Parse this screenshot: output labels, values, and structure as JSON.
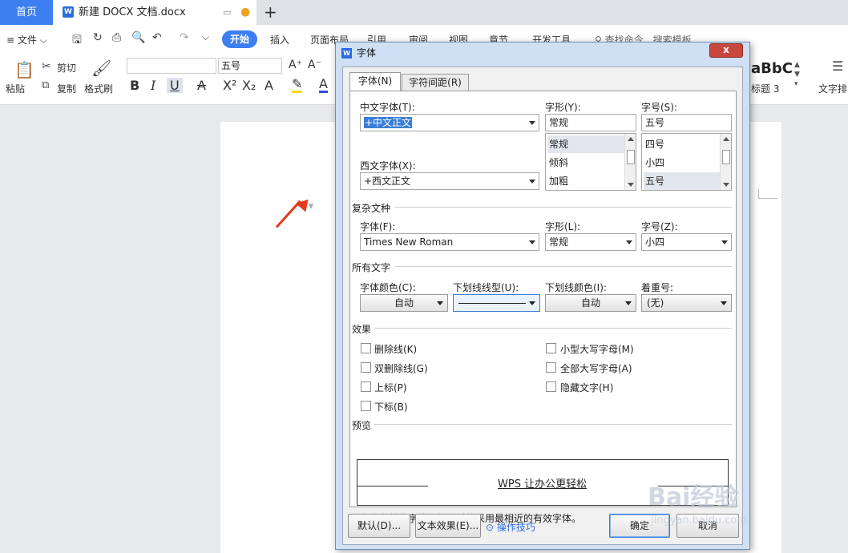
{
  "tabs": {
    "home": "首页",
    "doc_title": "新建 DOCX 文档.docx",
    "new_tab": "+"
  },
  "menu": {
    "file": "文件",
    "start": "开始",
    "insert": "插入",
    "layout": "页面布局",
    "reference": "引用",
    "review": "审阅",
    "view": "视图",
    "section": "章节",
    "dev": "开发工具",
    "search": "查找命令、搜索模板"
  },
  "ribbon": {
    "cut": "剪切",
    "paste": "粘贴",
    "copy": "复制",
    "format_painter": "格式刷",
    "font_size": "五号",
    "style_preview": "aBbC",
    "style_name": "标题 3",
    "text_layout": "文字排"
  },
  "dialog": {
    "title": "字体",
    "close": "x",
    "tab_font": "字体(N)",
    "tab_spacing": "字符间距(R)",
    "cn_font_label": "中文字体(T):",
    "cn_font_value": "+中文正文",
    "style_label": "字形(Y):",
    "style_value": "常规",
    "style_options": [
      "常规",
      "倾斜",
      "加粗"
    ],
    "size_label": "字号(S):",
    "size_value": "五号",
    "size_options": [
      "四号",
      "小四",
      "五号"
    ],
    "west_font_label": "西文字体(X):",
    "west_font_value": "+西文正文",
    "complex_section": "复杂文种",
    "complex_font_label": "字体(F):",
    "complex_font_value": "Times New Roman",
    "complex_style_label": "字形(L):",
    "complex_style_value": "常规",
    "complex_size_label": "字号(Z):",
    "complex_size_value": "小四",
    "all_text_section": "所有文字",
    "font_color_label": "字体颜色(C):",
    "font_color_value": "自动",
    "underline_type_label": "下划线线型(U):",
    "underline_color_label": "下划线颜色(I):",
    "underline_color_value": "自动",
    "emphasis_label": "着重号:",
    "emphasis_value": "(无)",
    "effects_section": "效果",
    "effects_left": [
      "删除线(K)",
      "双删除线(G)",
      "上标(P)",
      "下标(B)"
    ],
    "effects_right": [
      "小型大写字母(M)",
      "全部大写字母(A)",
      "隐藏文字(H)"
    ],
    "preview_section": "预览",
    "preview_text": "WPS 让办公更轻松",
    "note": "尚未安装此字体，打印时将采用最相近的有效字体。",
    "btn_default": "默认(D)...",
    "btn_text_effect": "文本效果(E)...",
    "tips": "操作技巧",
    "btn_ok": "确定",
    "btn_cancel": "取消"
  },
  "watermark": {
    "text": "Bai经验",
    "url": "jingyan.baidu.com"
  },
  "colors": {
    "accent": "#3d7ef0",
    "arrow": "#e53b1b"
  }
}
